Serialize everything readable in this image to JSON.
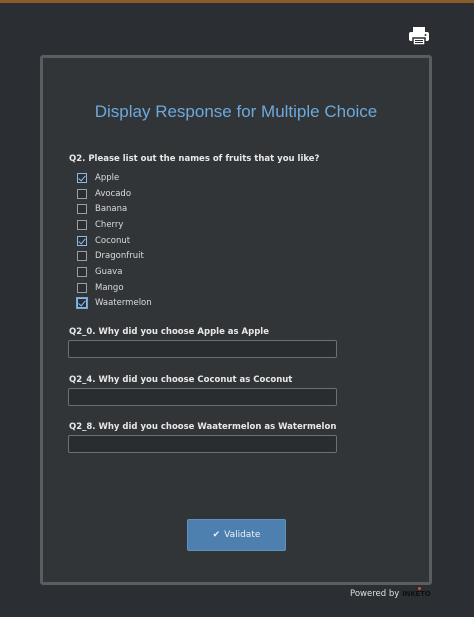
{
  "form": {
    "title": "Display Response for Multiple Choice",
    "q2": {
      "label": "Q2. Please list out the names of fruits that you like?",
      "options": [
        {
          "label": "Apple",
          "checked": true
        },
        {
          "label": "Avocado",
          "checked": false
        },
        {
          "label": "Banana",
          "checked": false
        },
        {
          "label": "Cherry",
          "checked": false
        },
        {
          "label": "Coconut",
          "checked": true
        },
        {
          "label": "Dragonfruit",
          "checked": false
        },
        {
          "label": "Guava",
          "checked": false
        },
        {
          "label": "Mango",
          "checked": false
        },
        {
          "label": "Waatermelon",
          "checked": true
        }
      ]
    },
    "followups": [
      {
        "label": "Q2_0. Why did you choose Apple as Apple",
        "value": ""
      },
      {
        "label": "Q2_4. Why did you choose Coconut as Coconut",
        "value": ""
      },
      {
        "label": "Q2_8. Why did you choose Waatermelon as Watermelon",
        "value": ""
      }
    ],
    "validate_label": "Validate"
  },
  "footer": {
    "powered_by": "Powered by",
    "brand": "INKETO"
  },
  "icons": {
    "print": "printer-icon",
    "validate": "check-icon"
  },
  "colors": {
    "background": "#2b2e32",
    "title": "#6ea8dc",
    "button": "#4d7faf"
  }
}
